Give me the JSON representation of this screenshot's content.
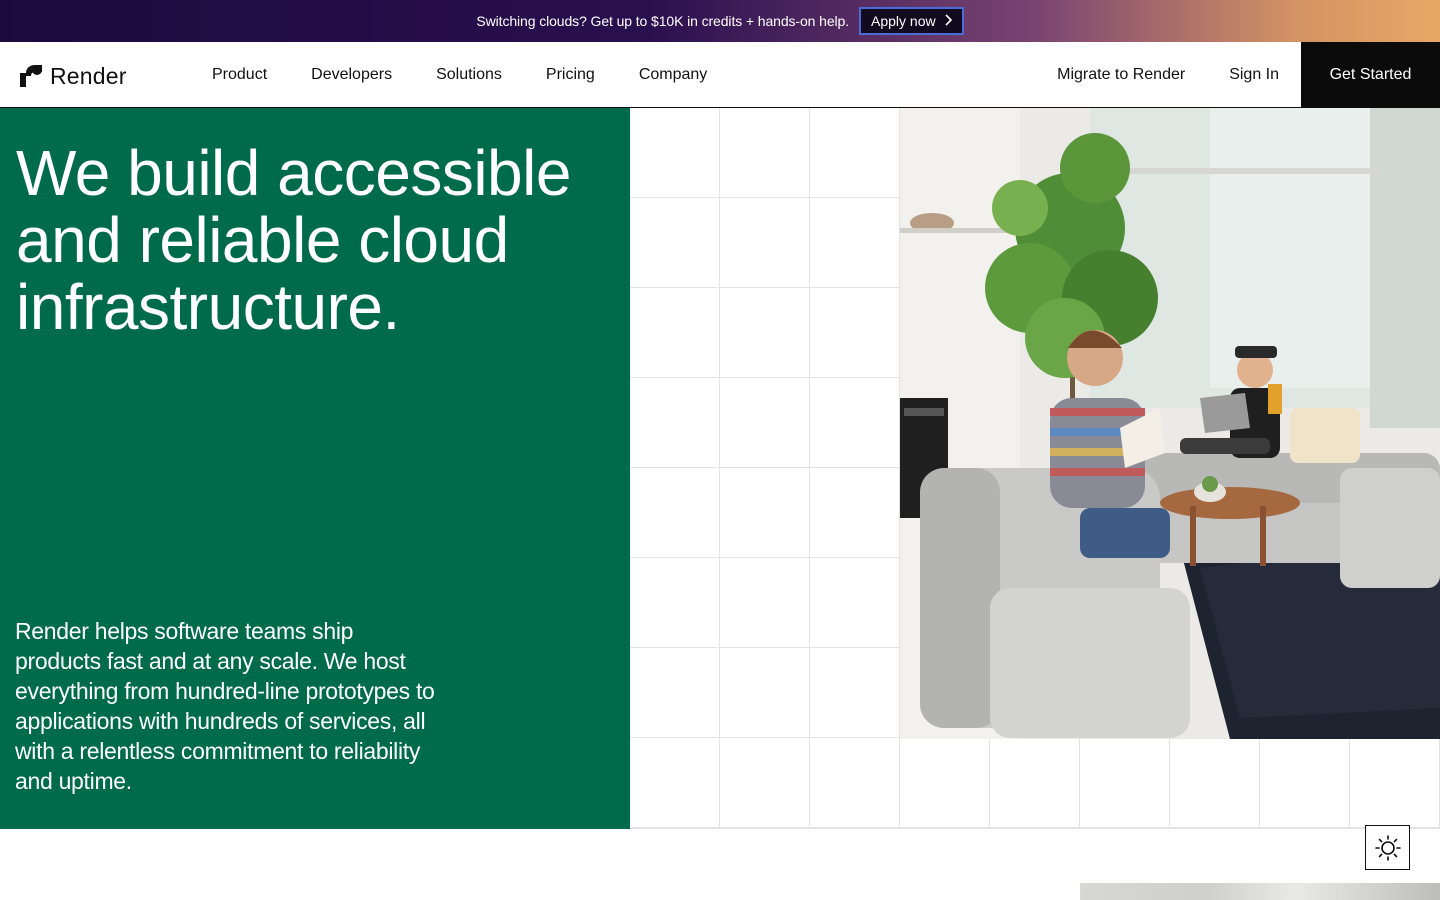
{
  "promo": {
    "text": "Switching clouds? Get up to $10K in credits + hands-on help.",
    "button_label": "Apply now"
  },
  "nav": {
    "logo_text": "Render",
    "links": [
      "Product",
      "Developers",
      "Solutions",
      "Pricing",
      "Company"
    ],
    "migrate": "Migrate to Render",
    "sign_in": "Sign In",
    "cta": "Get Started"
  },
  "hero": {
    "title": "We build accessible and reliable cloud infrastructure.",
    "subtitle": "Render helps software teams ship products fast and at any scale. We host everything from hundred-line prototypes to applications with hundreds of services, all with a relentless commitment to reliability and uptime."
  },
  "colors": {
    "brand_green": "#006b4a",
    "cta_black": "#0b0b0b"
  },
  "icons": {
    "logo": "render-logo-icon",
    "chevron": "chevron-right-icon",
    "theme": "sun-icon"
  }
}
